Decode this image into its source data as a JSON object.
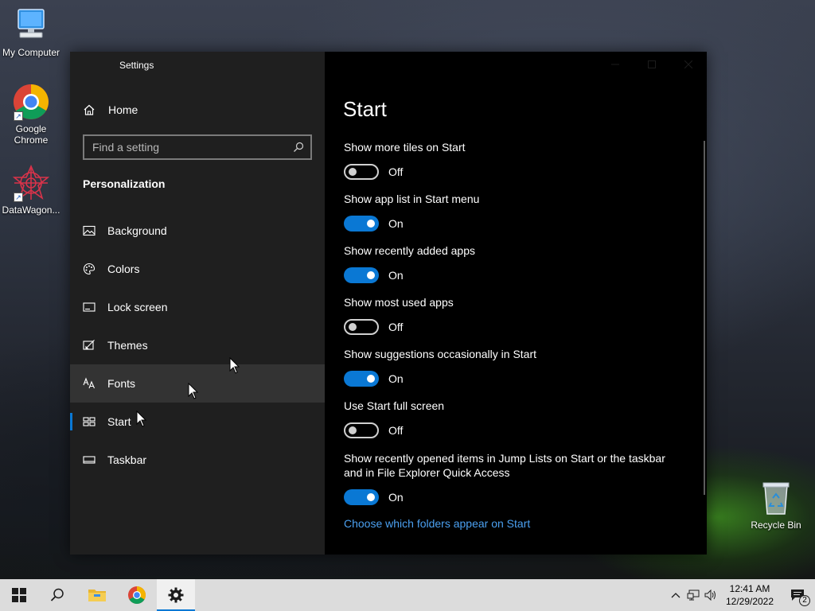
{
  "desktop": {
    "icons": [
      {
        "label": "My Computer"
      },
      {
        "label": "Google Chrome"
      },
      {
        "label": "DataWagon..."
      },
      {
        "label": "Recycle Bin"
      }
    ]
  },
  "window": {
    "app_title": "Settings",
    "nav": {
      "home_label": "Home",
      "search_placeholder": "Find a setting",
      "section_title": "Personalization",
      "items": [
        {
          "label": "Background",
          "icon": "image-icon"
        },
        {
          "label": "Colors",
          "icon": "palette-icon"
        },
        {
          "label": "Lock screen",
          "icon": "lock-screen-icon"
        },
        {
          "label": "Themes",
          "icon": "themes-icon"
        },
        {
          "label": "Fonts",
          "icon": "fonts-icon"
        },
        {
          "label": "Start",
          "icon": "start-icon"
        },
        {
          "label": "Taskbar",
          "icon": "taskbar-icon"
        }
      ],
      "selected": "Start",
      "hovered": "Fonts"
    },
    "content": {
      "title": "Start",
      "settings": [
        {
          "label": "Show more tiles on Start",
          "state": "off",
          "state_label": "Off"
        },
        {
          "label": "Show app list in Start menu",
          "state": "on",
          "state_label": "On"
        },
        {
          "label": "Show recently added apps",
          "state": "on",
          "state_label": "On"
        },
        {
          "label": "Show most used apps",
          "state": "off",
          "state_label": "Off"
        },
        {
          "label": "Show suggestions occasionally in Start",
          "state": "on",
          "state_label": "On"
        },
        {
          "label": "Use Start full screen",
          "state": "off",
          "state_label": "Off"
        },
        {
          "label": "Show recently opened items in Jump Lists on Start or the taskbar and in File Explorer Quick Access",
          "state": "on",
          "state_label": "On"
        }
      ],
      "link": "Choose which folders appear on Start"
    }
  },
  "taskbar": {
    "time": "12:41 AM",
    "date": "12/29/2022",
    "notification_count": "2"
  },
  "colors": {
    "accent": "#0a78d4",
    "link": "#4ba0f0"
  }
}
